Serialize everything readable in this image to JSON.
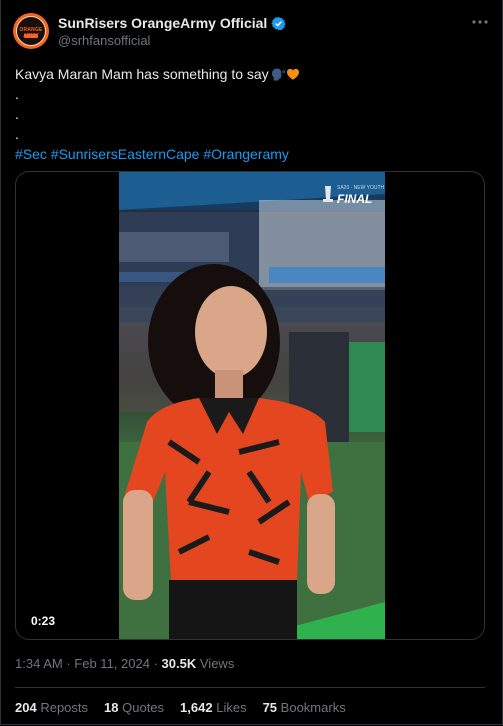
{
  "author": {
    "display_name": "SunRisers OrangeArmy Official",
    "handle": "@srhfansofficial",
    "avatar_text": "ORANGE ARMY",
    "verified": true
  },
  "tweet": {
    "text_line1": "Kavya Maran Mam has something to say",
    "dots": [
      ".",
      ".",
      "."
    ],
    "hashtags": [
      "#Sec",
      "#SunrisersEasternCape",
      "#Orangeramy"
    ]
  },
  "media": {
    "duration": "0:23",
    "final_badge": "FINAL"
  },
  "meta": {
    "time": "1:34 AM",
    "separator": "·",
    "date": "Feb 11, 2024",
    "views_count": "30.5K",
    "views_label": "Views"
  },
  "stats": {
    "reposts": {
      "count": "204",
      "label": "Reposts"
    },
    "quotes": {
      "count": "18",
      "label": "Quotes"
    },
    "likes": {
      "count": "1,642",
      "label": "Likes"
    },
    "bookmarks": {
      "count": "75",
      "label": "Bookmarks"
    }
  },
  "colors": {
    "background": "#000000",
    "text": "#e7e9ea",
    "muted": "#71767b",
    "link": "#1d9bf0",
    "verified": "#1d9bf0",
    "brand_orange": "#f26522"
  }
}
